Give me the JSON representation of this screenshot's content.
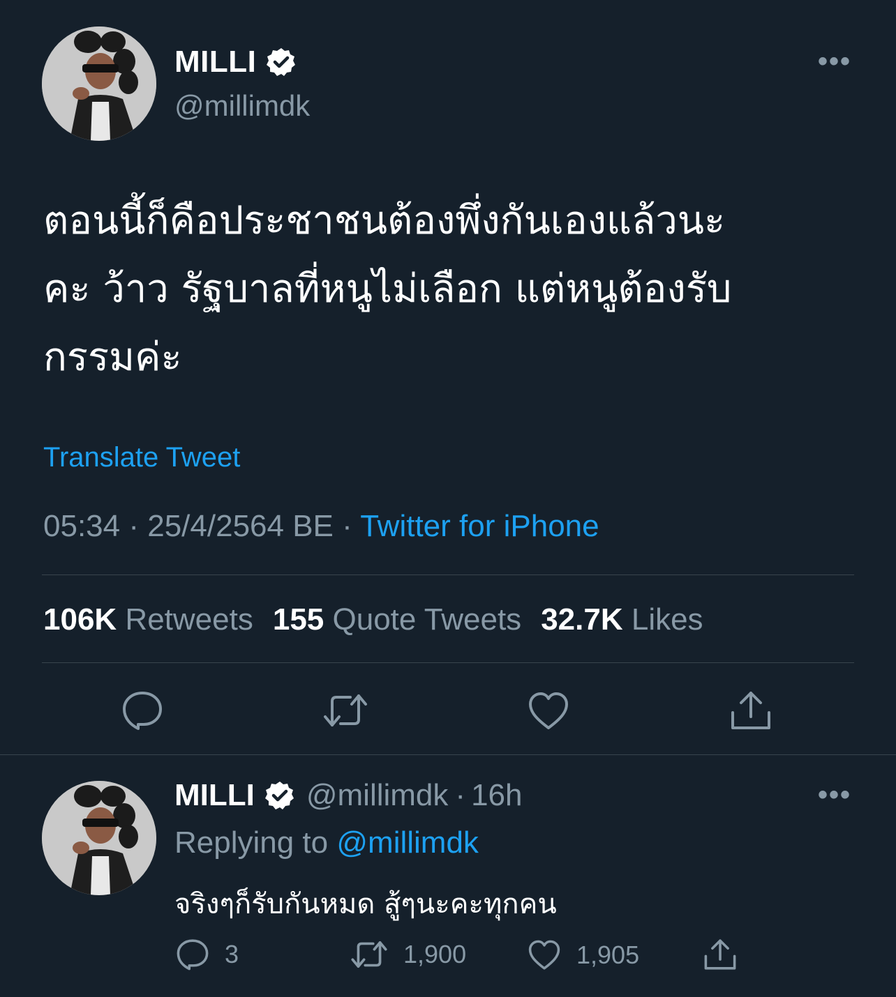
{
  "main_tweet": {
    "author": {
      "name": "MILLI",
      "handle": "@millimdk"
    },
    "more_label": "•••",
    "text_lines": [
      "ตอนนี้ก็คือประชาชนต้องพึ่งกันเองแล้วนะ",
      "คะ ว้าว รัฐบาลที่หนูไม่เลือก แต่หนูต้องรับ",
      "กรรมค่ะ"
    ],
    "translate_label": "Translate Tweet",
    "time": "05:34",
    "sep": "·",
    "date": "25/4/2564 BE",
    "source": "Twitter for iPhone",
    "stats": {
      "retweets_count": "106K",
      "retweets_label": "Retweets",
      "quotes_count": "155",
      "quotes_label": "Quote Tweets",
      "likes_count": "32.7K",
      "likes_label": "Likes"
    }
  },
  "reply": {
    "author": {
      "name": "MILLI",
      "handle": "@millimdk",
      "time": "16h"
    },
    "sep": "·",
    "more_label": "•••",
    "replying_to_label": "Replying to",
    "replying_to_handle": "@millimdk",
    "text": "จริงๆก็รับกันหมด สู้ๆนะคะทุกคน",
    "counts": {
      "replies": "3",
      "retweets": "1,900",
      "likes": "1,905"
    }
  },
  "colors": {
    "background": "#15202b",
    "accent": "#1da1f2",
    "secondary_text": "#8899a6",
    "divider": "#38444d"
  },
  "icons": [
    "verified-badge-icon",
    "more-icon",
    "reply-icon",
    "retweet-icon",
    "like-icon",
    "share-icon"
  ]
}
